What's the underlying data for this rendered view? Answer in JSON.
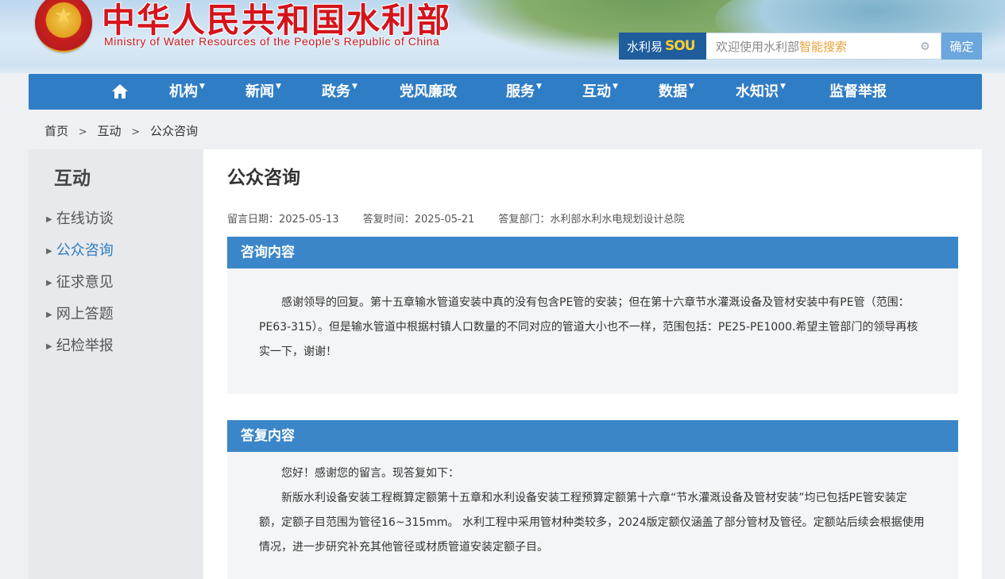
{
  "header": {
    "title": "中华人民共和国水利部",
    "subtitle": "Ministry of Water Resources of the People's Republic of China",
    "emblem_icon": "national-emblem-icon"
  },
  "search": {
    "brand": "水利易",
    "brand_sou": "SOU",
    "placeholder_prefix": "欢迎使用水利部",
    "placeholder_highlight": "智能搜索",
    "button": "确定"
  },
  "nav": {
    "items": [
      {
        "label": "机构"
      },
      {
        "label": "新闻"
      },
      {
        "label": "政务"
      },
      {
        "label": "党风廉政"
      },
      {
        "label": "服务"
      },
      {
        "label": "互动"
      },
      {
        "label": "数据"
      },
      {
        "label": "水知识"
      },
      {
        "label": "监督举报"
      }
    ],
    "caret": "▼"
  },
  "breadcrumb": {
    "items": [
      "首页",
      "互动",
      "公众咨询"
    ],
    "separator": ">"
  },
  "sidebar": {
    "title": "互动",
    "items": [
      {
        "label": "在线访谈"
      },
      {
        "label": "公众咨询"
      },
      {
        "label": "征求意见"
      },
      {
        "label": "网上答题"
      },
      {
        "label": "纪检举报"
      }
    ]
  },
  "main": {
    "title": "公众咨询",
    "meta": {
      "message_date": "留言日期：2025-05-13",
      "reply_date": "答复时间：2025-05-21",
      "reply_dept": "答复部门：水利部水利水电规划设计总院"
    },
    "inquiry": {
      "heading": "咨询内容",
      "text": "感谢领导的回复。第十五章输水管道安装中真的没有包含PE管的安装；但在第十六章节水灌溉设备及管材安装中有PE管（范围：PE63-315）。但是输水管道中根据村镇人口数量的不同对应的管道大小也不一样，范围包括：PE25-PE1000.希望主管部门的领导再核实一下，谢谢！"
    },
    "reply": {
      "heading": "答复内容",
      "p1": "您好！感谢您的留言。现答复如下：",
      "p2": "新版水利设备安装工程概算定额第十五章和水利设备安装工程预算定额第十六章“节水灌溉设备及管材安装”均已包括PE管安装定额，定额子目范围为管径16~315mm。 水利工程中采用管材种类较多，2024版定额仅涵盖了部分管材及管径。定额站后续会根据使用情况，进一步研究补充其他管径或材质管道安装定额子目。"
    }
  },
  "colors": {
    "nav_bg": "#2f7dc5",
    "panel_head": "#3a86c8",
    "title_red": "#d4141c",
    "active_link": "#2f7dc5"
  }
}
